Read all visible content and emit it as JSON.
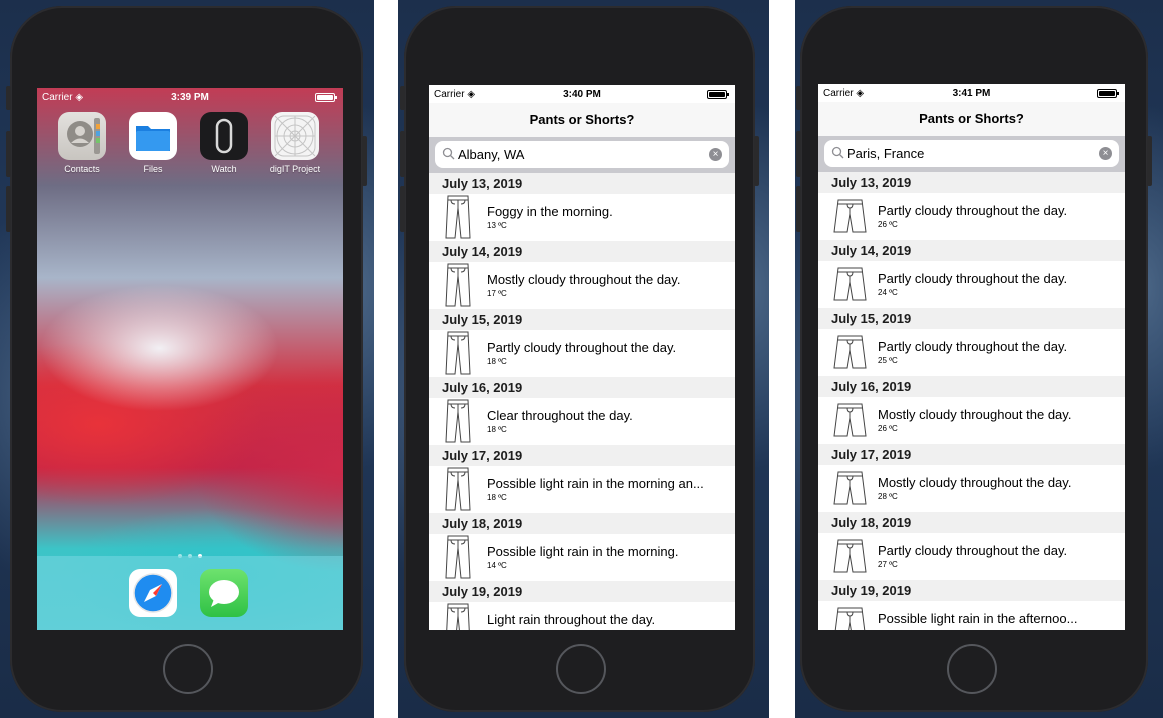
{
  "home_screen": {
    "status": {
      "carrier": "Carrier",
      "time": "3:39 PM"
    },
    "apps": [
      {
        "label": "Contacts",
        "icon": "contacts-icon"
      },
      {
        "label": "Files",
        "icon": "files-icon"
      },
      {
        "label": "Watch",
        "icon": "watch-icon"
      },
      {
        "label": "digIT Project",
        "icon": "digit-project-icon"
      }
    ],
    "dock": [
      {
        "icon": "safari-icon"
      },
      {
        "icon": "messages-icon"
      }
    ]
  },
  "app_albany": {
    "status": {
      "carrier": "Carrier",
      "time": "3:40 PM"
    },
    "title": "Pants or Shorts?",
    "search_value": "Albany, WA",
    "days": [
      {
        "date": "July 13, 2019",
        "summary": "Foggy in the morning.",
        "temp": "13 ºC",
        "garment": "pants-icon"
      },
      {
        "date": "July 14, 2019",
        "summary": "Mostly cloudy throughout the day.",
        "temp": "17 ºC",
        "garment": "pants-icon"
      },
      {
        "date": "July 15, 2019",
        "summary": "Partly cloudy throughout the day.",
        "temp": "18 ºC",
        "garment": "pants-icon"
      },
      {
        "date": "July 16, 2019",
        "summary": "Clear throughout the day.",
        "temp": "18 ºC",
        "garment": "pants-icon"
      },
      {
        "date": "July 17, 2019",
        "summary": "Possible light rain in the morning an...",
        "temp": "18 ºC",
        "garment": "pants-icon"
      },
      {
        "date": "July 18, 2019",
        "summary": "Possible light rain in the morning.",
        "temp": "14 ºC",
        "garment": "pants-icon"
      },
      {
        "date": "July 19, 2019",
        "summary": "Light rain throughout the day.",
        "temp": "",
        "garment": "pants-icon"
      }
    ]
  },
  "app_paris": {
    "status": {
      "carrier": "Carrier",
      "time": "3:41 PM"
    },
    "title": "Pants or Shorts?",
    "search_value": "Paris, France",
    "days": [
      {
        "date": "July 13, 2019",
        "summary": "Partly cloudy throughout the day.",
        "temp": "26 ºC",
        "garment": "shorts-icon"
      },
      {
        "date": "July 14, 2019",
        "summary": "Partly cloudy throughout the day.",
        "temp": "24 ºC",
        "garment": "shorts-icon"
      },
      {
        "date": "July 15, 2019",
        "summary": "Partly cloudy throughout the day.",
        "temp": "25 ºC",
        "garment": "shorts-icon"
      },
      {
        "date": "July 16, 2019",
        "summary": "Mostly cloudy throughout the day.",
        "temp": "26 ºC",
        "garment": "shorts-icon"
      },
      {
        "date": "July 17, 2019",
        "summary": "Mostly cloudy throughout the day.",
        "temp": "28 ºC",
        "garment": "shorts-icon"
      },
      {
        "date": "July 18, 2019",
        "summary": "Partly cloudy throughout the day.",
        "temp": "27 ºC",
        "garment": "shorts-icon"
      },
      {
        "date": "July 19, 2019",
        "summary": "Possible light rain in the afternoo...",
        "temp": "",
        "garment": "shorts-icon"
      }
    ]
  }
}
